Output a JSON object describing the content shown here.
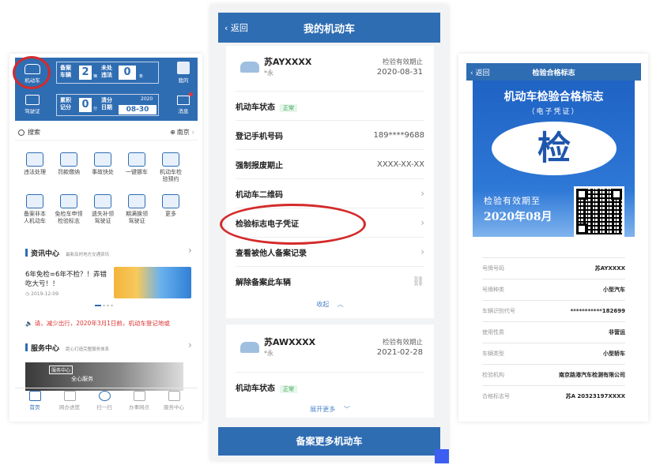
{
  "panel1": {
    "vehicle_label": "机动车",
    "filed_vehicles_label": "备案\n车辆",
    "filed_count": "2",
    "filed_unit": "辆",
    "unhandled_label": "未处\n违法",
    "unhandled_count": "0",
    "unhandled_unit": "条",
    "mine_label": "我的",
    "license_label": "驾驶证",
    "points_label": "累积\n记分",
    "points_value": "0",
    "points_unit": "分",
    "clear_label": "清分\n日期",
    "clear_year": "2020",
    "clear_date": "08-30",
    "message_label": "消息",
    "search_label": "搜索",
    "city_label": "南京",
    "services": [
      "违法处理",
      "罚款缴纳",
      "事故快处",
      "一键挪车",
      "机动车检\n验预约",
      "备案非本\n人机动车",
      "免检车申领\n检验标志",
      "遗失补领\n驾驶证",
      "期满换领\n驾驶证",
      "更多"
    ],
    "news_title": "资讯中心",
    "news_sub": "最新及时地方交通资讯",
    "news_headline": "6年免检=6年不检？！弄错吃大亏！！",
    "news_date": "2019-12-09",
    "notice": "请，减少出行，2020年3月1日前，机动车登记地或",
    "service_title": "服务中心",
    "service_sub": "距心打造完整服务体系",
    "service_banner_tag": "服务中心",
    "service_banner_text": "全心服务",
    "tabs": [
      "首页",
      "网办进度",
      "扫一扫",
      "办事网点",
      "服务中心"
    ]
  },
  "panel2": {
    "back_label": "返回",
    "title": "我的机动车",
    "car1_plate": "苏AYXXXX",
    "car1_sub": "*永",
    "car1_valid_label": "检验有效期止",
    "car1_valid_date": "2020-08-31",
    "status_label": "机动车状态",
    "status_value": "正常",
    "phone_label": "登记手机号码",
    "phone_value": "189****9688",
    "scrap_label": "强制报废期止",
    "scrap_value": "XXXX-XX-XX",
    "qr_label": "机动车二维码",
    "cert_label": "检验标志电子凭证",
    "records_label": "查看被他人备案记录",
    "remove_label": "解除备案此车辆",
    "collapse_label": "收起",
    "car2_plate": "苏AWXXXX",
    "car2_sub": "*永",
    "car2_valid_label": "检验有效期止",
    "car2_valid_date": "2021-02-28",
    "expand_label": "展开更多",
    "add_button": "备案更多机动车"
  },
  "panel3": {
    "back_label": "返回",
    "title": "检验合格标志",
    "cert_title": "机动车检验合格标志",
    "cert_subtitle": "（电子凭证）",
    "seal_char": "检",
    "valid_label": "检验有效期至",
    "valid_value": "2020年08月",
    "rows": [
      {
        "k": "号牌号码",
        "v": "苏AYXXXX"
      },
      {
        "k": "号牌种类",
        "v": "小型汽车"
      },
      {
        "k": "车辆识别代号",
        "v": "***********182699"
      },
      {
        "k": "使用性质",
        "v": "非营运"
      },
      {
        "k": "车辆类型",
        "v": "小型轿车"
      },
      {
        "k": "检验机构",
        "v": "南京路港汽车检测有限公司"
      },
      {
        "k": "合格标志号",
        "v": "苏A 20323197XXXX"
      }
    ]
  },
  "colors": {
    "primary": "#2f6db3",
    "highlight": "#d42a2a",
    "ok": "#3aa655"
  }
}
